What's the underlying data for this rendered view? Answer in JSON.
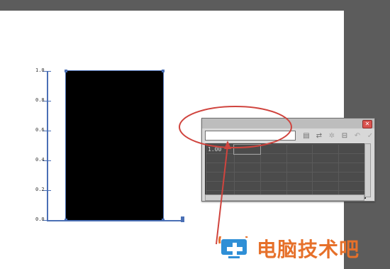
{
  "chart": {
    "y_ticks": [
      "1.0",
      "0.8",
      "0.6",
      "0.4",
      "0.2",
      "0.0"
    ]
  },
  "chart_data": {
    "type": "bar",
    "categories": [
      ""
    ],
    "values": [
      1.0
    ],
    "ylim": [
      0,
      1.0
    ]
  },
  "editor": {
    "input_value": "",
    "grid": {
      "rows": [
        [
          "1.00",
          "",
          "",
          "",
          "",
          ""
        ],
        [
          "",
          "",
          "",
          "",
          "",
          ""
        ],
        [
          "",
          "",
          "",
          "",
          "",
          ""
        ],
        [
          "",
          "",
          "",
          "",
          "",
          ""
        ],
        [
          "",
          "",
          "",
          "",
          "",
          ""
        ],
        [
          "",
          "",
          "",
          "",
          "",
          ""
        ]
      ]
    }
  },
  "toolbar_icons": [
    "import-data-icon",
    "transpose-icon",
    "switch-xy-icon",
    "cell-style-icon",
    "revert-icon",
    "apply-icon"
  ],
  "colors": {
    "axis": "#4a6fb5",
    "bar": "#000000",
    "annotation": "#d0443e",
    "watermark": "#e6702a"
  },
  "watermark": {
    "text": "电脑技术吧"
  }
}
